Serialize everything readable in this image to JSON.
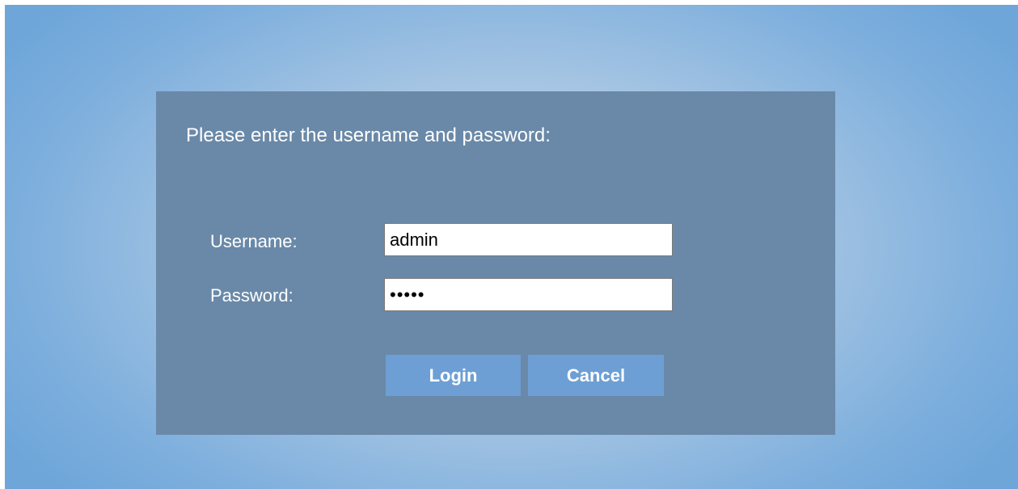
{
  "login_dialog": {
    "prompt": "Please enter the username and password:",
    "username_label": "Username:",
    "username_value": "admin",
    "password_label": "Password:",
    "password_value": "admin",
    "login_label": "Login",
    "cancel_label": "Cancel"
  },
  "colors": {
    "background_center": "#c3d7ea",
    "background_edge": "#6ea6da",
    "dialog_bg": "#6a89a8",
    "button_bg": "#6d9fd4",
    "text": "#ffffff"
  }
}
